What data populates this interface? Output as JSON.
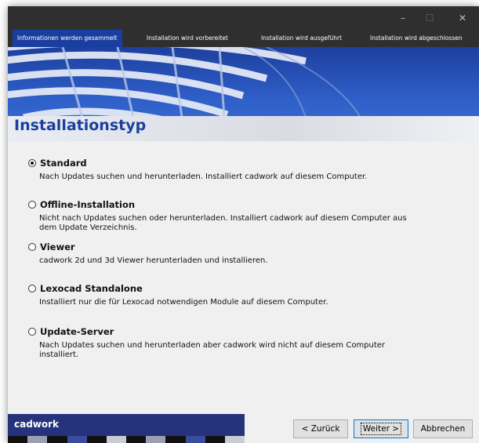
{
  "window": {
    "controls": {
      "minimize": "–",
      "maximize": "☐",
      "close": "✕"
    }
  },
  "steps": [
    {
      "label": "Informationen werden gesammelt",
      "active": true
    },
    {
      "label": "Installation wird vorbereitet",
      "active": false
    },
    {
      "label": "Installation wird ausgeführt",
      "active": false
    },
    {
      "label": "Installation wird abgeschlossen",
      "active": false
    }
  ],
  "page": {
    "title": "Installationstyp"
  },
  "options": [
    {
      "label": "Standard",
      "desc": "Nach Updates suchen und herunterladen. Installiert cadwork auf diesem Computer.",
      "checked": true
    },
    {
      "label": "Offline-Installation",
      "desc": "Nicht nach Updates suchen oder herunterladen. Installiert cadwork auf diesem Computer aus dem Update Verzeichnis.",
      "checked": false
    },
    {
      "label": "Viewer",
      "desc": "cadwork 2d und 3d Viewer herunterladen und installieren.",
      "checked": false
    },
    {
      "label": "Lexocad Standalone",
      "desc": "Installiert nur die für Lexocad notwendigen Module auf diesem Computer.",
      "checked": false
    },
    {
      "label": "Update-Server",
      "desc": "Nach Updates suchen und herunterladen aber cadwork wird nicht auf diesem Computer installiert.",
      "checked": false
    }
  ],
  "footer": {
    "brand": "cadwork",
    "buttons": {
      "back": "< Zurück",
      "next": "Weiter >",
      "cancel": "Abbrechen"
    }
  },
  "colors": {
    "accent": "#1a3fa0",
    "brand_bg": "#24337c",
    "titlebar": "#2f2f2f"
  }
}
